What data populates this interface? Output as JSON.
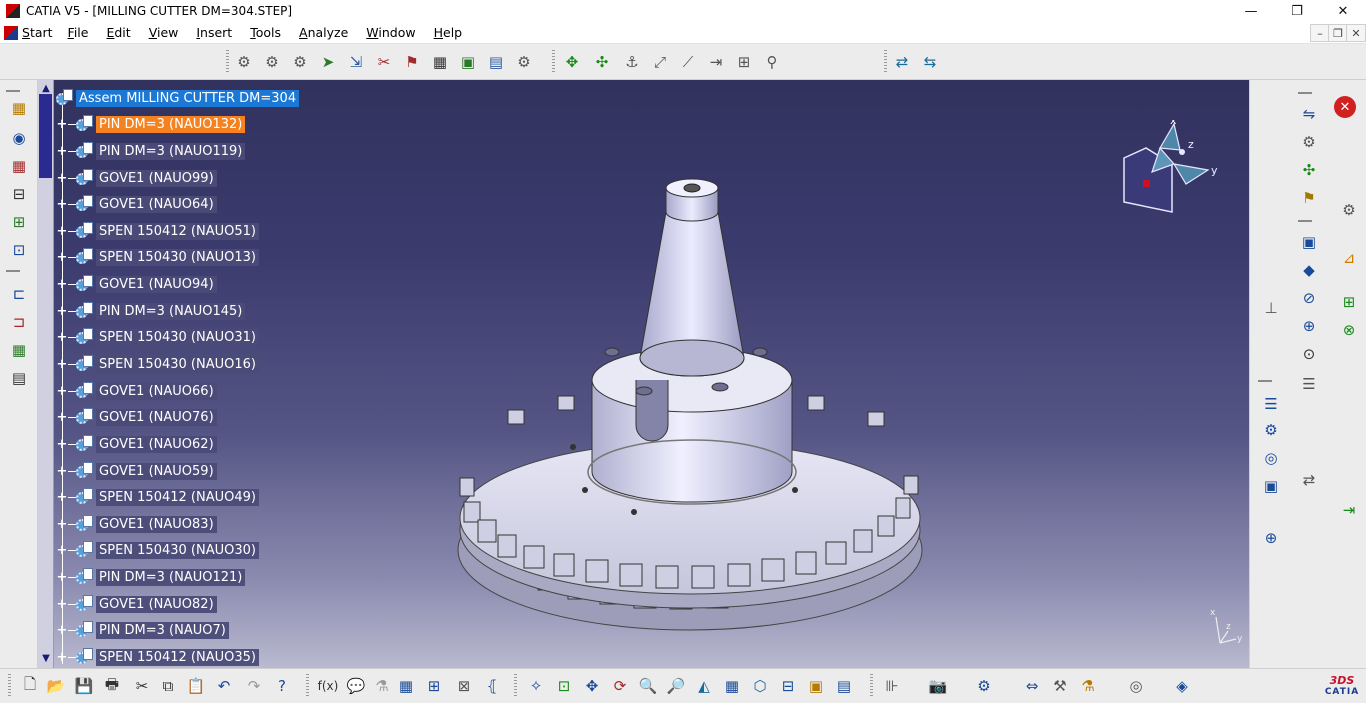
{
  "window": {
    "title": "CATIA V5 - [MILLING CUTTER DM=304.STEP]",
    "controls": [
      "minimize",
      "restore",
      "close"
    ],
    "minimize_glyph": "—",
    "restore_glyph": "❐",
    "close_glyph": "✕"
  },
  "menubar": {
    "start": {
      "underline": "S",
      "rest": "tart"
    },
    "items": [
      {
        "underline": "F",
        "rest": "ile"
      },
      {
        "underline": "E",
        "rest": "dit"
      },
      {
        "underline": "V",
        "rest": "iew"
      },
      {
        "underline": "I",
        "rest": "nsert"
      },
      {
        "underline": "T",
        "rest": "ools"
      },
      {
        "underline": "A",
        "rest": "nalyze"
      },
      {
        "underline": "W",
        "rest": "indow"
      },
      {
        "underline": "H",
        "rest": "elp"
      }
    ],
    "doc_min": "–",
    "doc_restore": "❐",
    "doc_close": "✕"
  },
  "top_toolbar": {
    "icons": [
      "⚙",
      "⚙",
      "⚙",
      "➤",
      "⇲",
      "✂",
      "⚑",
      "▦",
      "▣",
      "▤",
      "⚙",
      "✥",
      "✣",
      "⚓",
      "⤢",
      "⟋",
      "⇥",
      "⊞",
      "⚲",
      "⇄",
      "⇆"
    ]
  },
  "left_toolbar": {
    "icons": [
      "▦",
      "◉",
      "▦",
      "⊟",
      "⊞",
      "⊡",
      "⊏",
      "⊐",
      "▦",
      "▤"
    ]
  },
  "right_toolbar": {
    "icons": [
      "⇋",
      "⚙",
      "✣",
      "⚑",
      "⚙",
      "▣",
      "◆",
      "⊿",
      "⊥",
      "⊘",
      "⊞",
      "⊕",
      "⊗",
      "⊙",
      "☰",
      "☰",
      "⚙",
      "◎",
      "▣",
      "⇄",
      "⇥",
      "⊕"
    ],
    "close_icon": "✕"
  },
  "tree": {
    "root_label": "Assem MILLING CUTTER DM=304",
    "expander": "+",
    "items": [
      "PIN DM=3 (NAUO132)",
      "PIN DM=3 (NAUO119)",
      "GOVE1 (NAUO99)",
      "GOVE1 (NAUO64)",
      "SPEN 150412 (NAUO51)",
      "SPEN 150430 (NAUO13)",
      "GOVE1 (NAUO94)",
      "PIN DM=3 (NAUO145)",
      "SPEN 150430 (NAUO31)",
      "SPEN 150430 (NAUO16)",
      "GOVE1 (NAUO66)",
      "GOVE1 (NAUO76)",
      "GOVE1 (NAUO62)",
      "GOVE1 (NAUO59)",
      "SPEN 150412 (NAUO49)",
      "GOVE1 (NAUO83)",
      "SPEN 150430 (NAUO30)",
      "PIN DM=3 (NAUO121)",
      "GOVE1 (NAUO82)",
      "PIN DM=3 (NAUO7)",
      "SPEN 150412 (NAUO35)"
    ],
    "selected_index": 0,
    "scroll_up": "▲",
    "scroll_down": "▼"
  },
  "compass": {
    "x": "x",
    "y": "y",
    "z": "z"
  },
  "mini_axis": {
    "x": "x",
    "y": "y",
    "z": "z"
  },
  "bottom_toolbar": {
    "icons": [
      "🗋",
      "📂",
      "💾",
      "🖶",
      "✂",
      "⧉",
      "📋",
      "↶",
      "↷",
      "?",
      "f(x)",
      "💬",
      "⚗",
      "▦",
      "⊞",
      "⊠",
      "⦃",
      "✧",
      "⊡",
      "✥",
      "⟳",
      "🔍",
      "🔎",
      "◭",
      "▦",
      "⬡",
      "⊟",
      "▣",
      "▤",
      "⊪",
      "📷",
      "⚙",
      "⇔",
      "⚒",
      "⚗",
      "◎",
      "◈"
    ]
  },
  "logo": {
    "brand": "CATIA",
    "mark": "3DS"
  },
  "colors": {
    "tree_selected": "#f58220",
    "tree_root": "#1b78d4",
    "viewport_top": "#32325e",
    "viewport_bottom": "#b9b9cf"
  }
}
